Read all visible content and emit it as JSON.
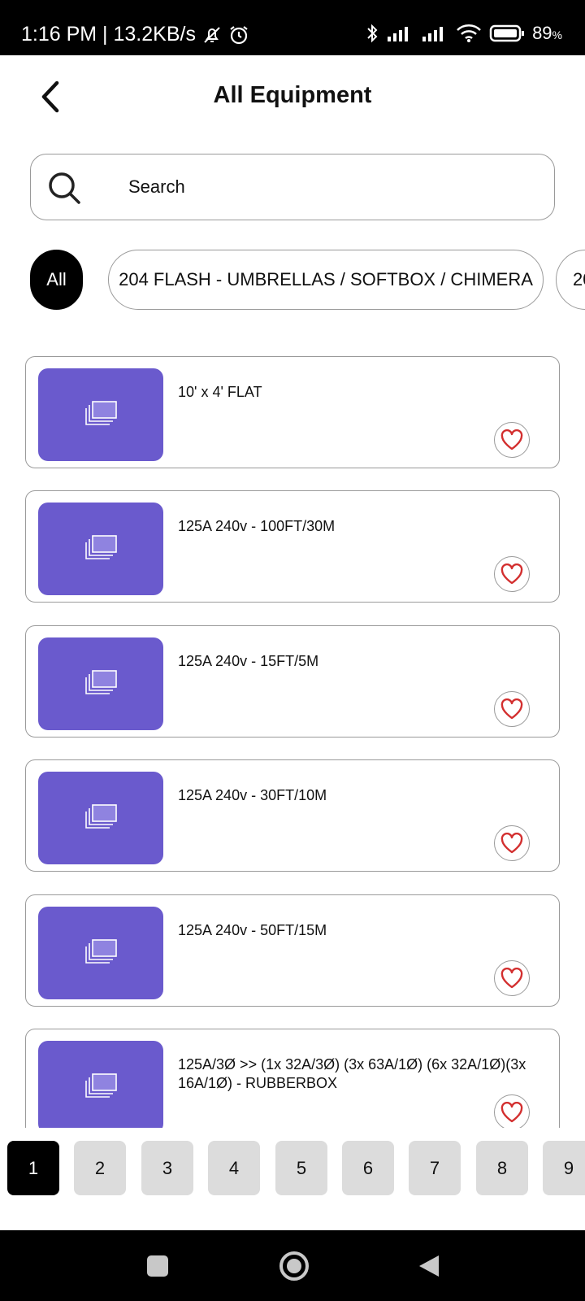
{
  "status_bar": {
    "time_info": "1:16 PM | 13.2KB/s",
    "battery_pct": "89",
    "battery_unit": "%",
    "icons": [
      "mute-bell-icon",
      "alarm-icon",
      "bluetooth-icon",
      "signal-icon",
      "signal-icon",
      "wifi-icon",
      "battery-icon"
    ]
  },
  "header": {
    "title": "All Equipment",
    "back_icon": "chevron-left-icon"
  },
  "search": {
    "placeholder": "Search",
    "icon": "search-icon"
  },
  "categories": [
    {
      "label": "All",
      "active": true
    },
    {
      "label": "204 FLASH - UMBRELLAS / SOFTBOX / CHIMERA",
      "active": false
    },
    {
      "label": "20",
      "active": false
    }
  ],
  "items": [
    {
      "name": "10' x 4' FLAT"
    },
    {
      "name": "125A 240v - 100FT/30M"
    },
    {
      "name": "125A 240v - 15FT/5M"
    },
    {
      "name": "125A 240v - 30FT/10M"
    },
    {
      "name": "125A 240v - 50FT/15M"
    },
    {
      "name": "125A/3Ø >> (1x 32A/3Ø) (3x 63A/1Ø) (6x 32A/1Ø)(3x 16A/1Ø) - RUBBERBOX"
    }
  ],
  "pagination": {
    "pages": [
      "1",
      "2",
      "3",
      "4",
      "5",
      "6",
      "7",
      "8",
      "9"
    ],
    "current": "1"
  },
  "colors": {
    "thumbnail": "#6a5acd",
    "heart": "#d32f2f",
    "active_chip": "#000000",
    "page_inactive": "#dcdcdc"
  }
}
